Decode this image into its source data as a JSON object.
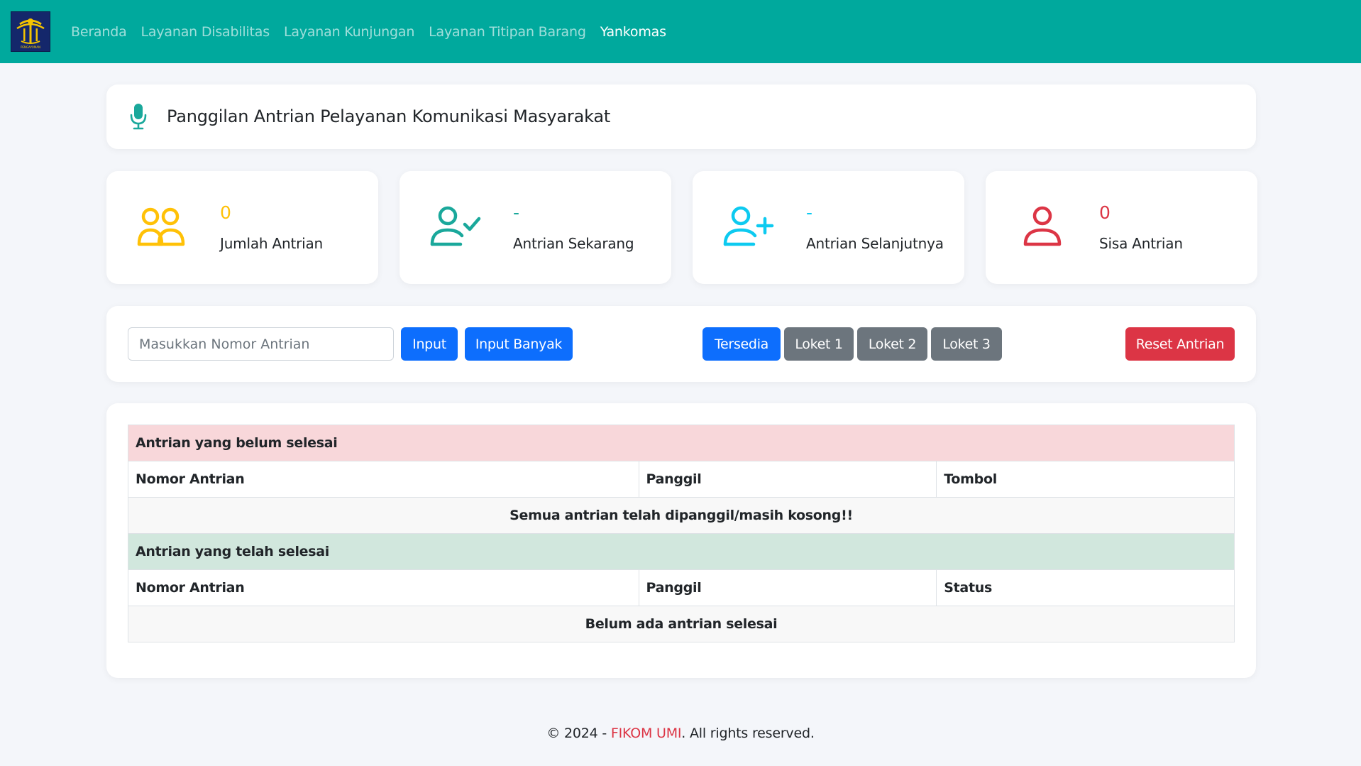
{
  "colors": {
    "navbar": "#00a99d",
    "accent_teal": "#1aa89b",
    "yellow": "#ffc107",
    "cyan": "#0dcaf0",
    "red": "#dc3545",
    "primary": "#0d6efd",
    "secondary": "#6c757d"
  },
  "nav": {
    "logo_text": "PENGAYOMAN",
    "items": [
      {
        "label": "Beranda",
        "active": false
      },
      {
        "label": "Layanan Disabilitas",
        "active": false
      },
      {
        "label": "Layanan Kunjungan",
        "active": false
      },
      {
        "label": "Layanan Titipan Barang",
        "active": false
      },
      {
        "label": "Yankomas",
        "active": true
      }
    ]
  },
  "header": {
    "icon": "microphone-icon",
    "title": "Panggilan Antrian Pelayanan Komunikasi Masyarakat"
  },
  "stats": [
    {
      "icon": "people-icon",
      "value": "0",
      "label": "Jumlah Antrian",
      "color": "#ffc107"
    },
    {
      "icon": "person-check-icon",
      "value": "-",
      "label": "Antrian Sekarang",
      "color": "#1aa89b"
    },
    {
      "icon": "person-plus-icon",
      "value": "-",
      "label": "Antrian Selanjutnya",
      "color": "#0dcaf0"
    },
    {
      "icon": "person-icon",
      "value": "0",
      "label": "Sisa Antrian",
      "color": "#dc3545"
    }
  ],
  "controls": {
    "input_placeholder": "Masukkan Nomor Antrian",
    "input_button": "Input",
    "input_many_button": "Input Banyak",
    "status_buttons": [
      "Tersedia",
      "Loket 1",
      "Loket 2",
      "Loket 3"
    ],
    "reset_button": "Reset Antrian"
  },
  "pending_table": {
    "title": "Antrian yang belum selesai",
    "columns": [
      "Nomor Antrian",
      "Panggil",
      "Tombol"
    ],
    "empty_message": "Semua antrian telah dipanggil/masih kosong!!"
  },
  "done_table": {
    "title": "Antrian yang telah selesai",
    "columns": [
      "Nomor Antrian",
      "Panggil",
      "Status"
    ],
    "empty_message": "Belum ada antrian selesai"
  },
  "footer": {
    "prefix": "© 2024 - ",
    "brand": "FIKOM UMI",
    "suffix": ". All rights reserved."
  }
}
